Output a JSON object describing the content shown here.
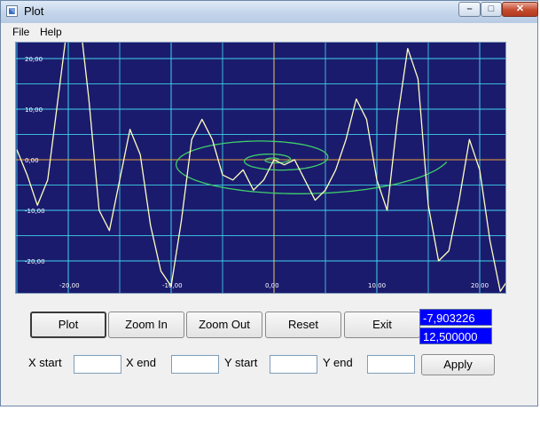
{
  "window": {
    "title": "Plot",
    "icon": "plot-app-icon"
  },
  "controls": {
    "minimize": "–",
    "maximize": "□",
    "close": "✕"
  },
  "menu": {
    "file": "File",
    "help": "Help"
  },
  "toolbar": {
    "plot": "Plot",
    "zoom_in": "Zoom In",
    "zoom_out": "Zoom Out",
    "reset": "Reset",
    "exit": "Exit",
    "apply": "Apply"
  },
  "coords": {
    "x": "-7,903226",
    "y": "12,500000"
  },
  "fields": {
    "x_start": {
      "label": "X start",
      "value": ""
    },
    "x_end": {
      "label": "X end",
      "value": ""
    },
    "y_start": {
      "label": "Y start",
      "value": ""
    },
    "y_end": {
      "label": "Y end",
      "value": ""
    }
  },
  "colors": {
    "plot_bg": "#1b1b6e",
    "grid": "#3fd4ea",
    "x_axis": "#e8a23c",
    "y_axis": "#e8c86a",
    "curve": "#ffffc0",
    "spiral": "#3fcf6a",
    "coord_bg": "#0000ff"
  },
  "chart_data": {
    "type": "line",
    "xlim": [
      -25,
      25
    ],
    "ylim": [
      -26,
      26
    ],
    "x_ticks": [
      -20,
      -10,
      0,
      10,
      20
    ],
    "y_ticks": [
      20,
      10,
      0,
      -10,
      -20
    ],
    "x_tick_labels": [
      "-20,00",
      "-10,00",
      "0,00",
      "10,00",
      "20,00"
    ],
    "y_tick_labels": [
      "20,00",
      "10,00",
      "0,00",
      "-10,00",
      "-20,00"
    ],
    "grid": true,
    "series": [
      {
        "style": "yellow-curve",
        "x": [
          -25,
          -24,
          -23,
          -22,
          -21,
          -20,
          -19,
          -18,
          -17,
          -16,
          -15,
          -14,
          -13,
          -12,
          -11,
          -10,
          -9,
          -8,
          -7,
          -6,
          -5,
          -4,
          -3,
          -2,
          -1,
          0,
          1,
          2,
          3,
          4,
          5,
          6,
          7,
          8,
          9,
          10,
          11,
          12,
          13,
          14,
          15,
          16,
          17,
          18,
          19,
          20,
          21,
          22,
          23,
          24,
          25
        ],
        "y": [
          2,
          -3,
          -9,
          -4,
          12,
          28,
          30,
          12,
          -10,
          -14,
          -4,
          6,
          1,
          -13,
          -22,
          -25,
          -12,
          4,
          8,
          4,
          -3,
          -4,
          -2,
          -6,
          -4,
          0,
          -1,
          0,
          -4,
          -8,
          -6,
          -2,
          4,
          12,
          8,
          -4,
          -10,
          8,
          22,
          16,
          -9,
          -20,
          -18,
          -8,
          4,
          -2,
          -16,
          -26,
          -23,
          -10,
          2
        ]
      },
      {
        "style": "green-spiral",
        "x": [],
        "y": []
      }
    ]
  }
}
